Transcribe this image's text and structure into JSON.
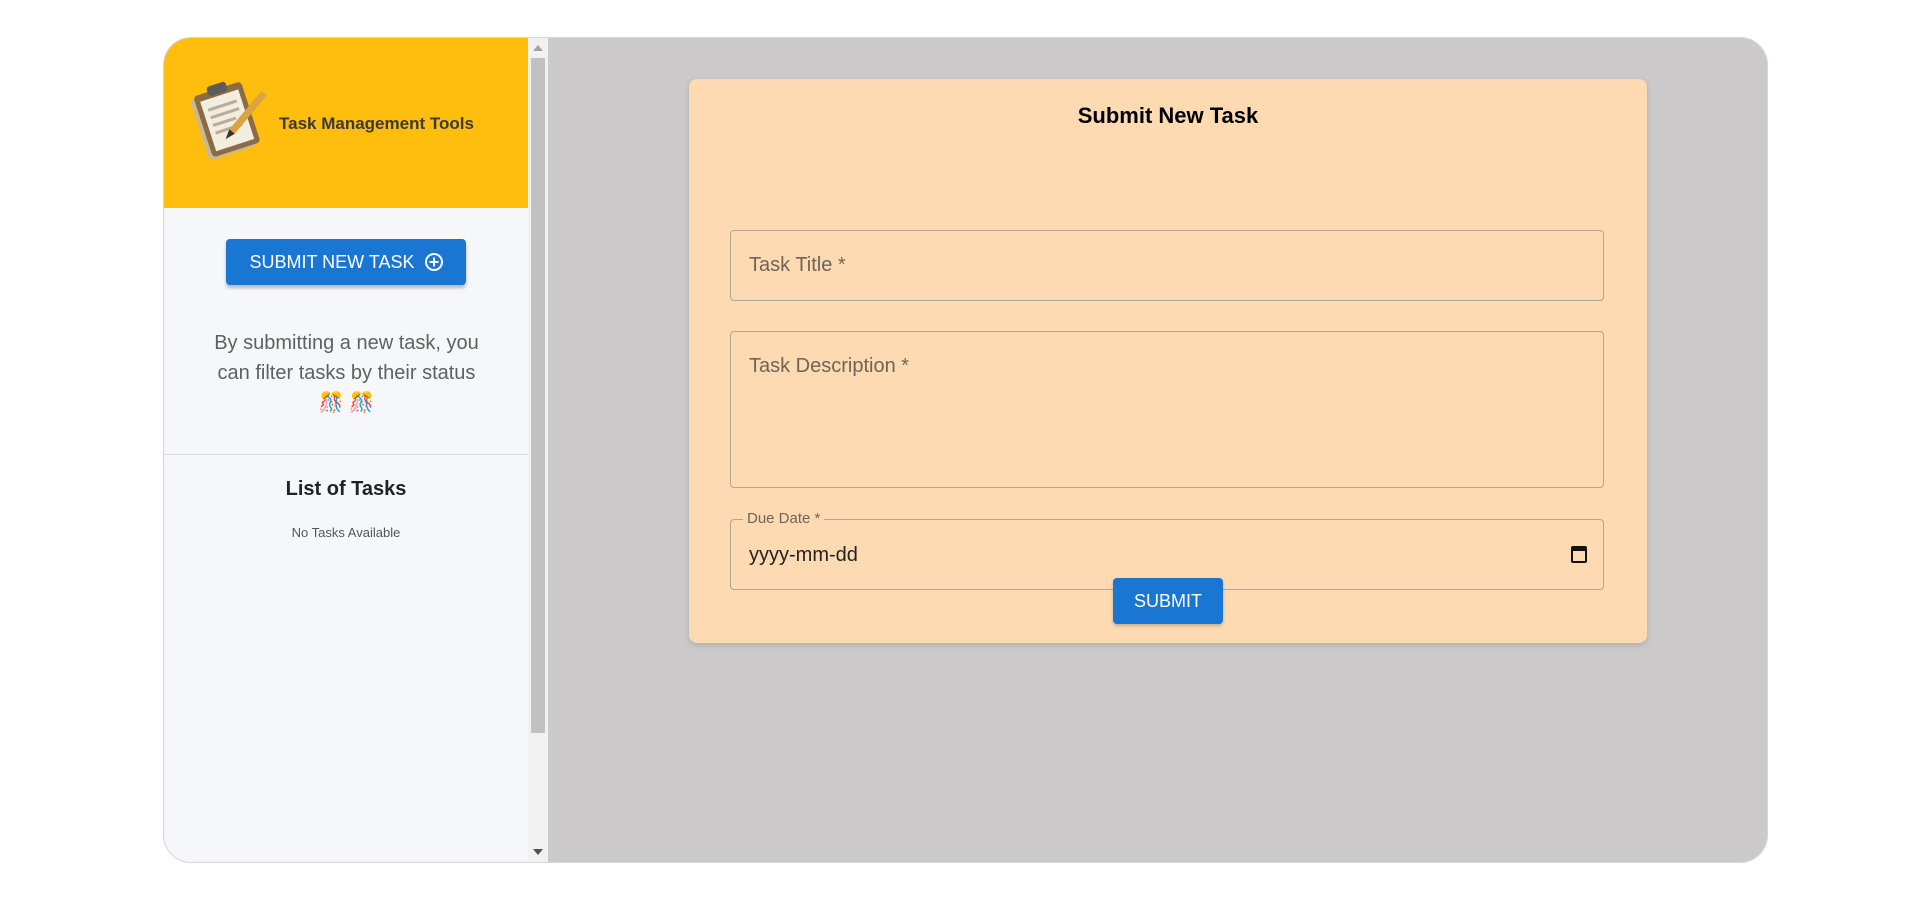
{
  "app": {
    "title": "Task Management Tools"
  },
  "sidebar": {
    "new_task_button": "SUBMIT NEW TASK",
    "new_task_icon": "plus-circle-icon",
    "info_text": "By submitting a new task, you can filter tasks by their status 🎊 🎊",
    "list_title": "List of Tasks",
    "empty_text": "No Tasks Available"
  },
  "form": {
    "title": "Submit New Task",
    "task_title_placeholder": "Task Title *",
    "task_description_placeholder": "Task Description *",
    "due_date_label": "Due Date *",
    "due_date_value": "yyyy-mm-dd",
    "submit_label": "SUBMIT"
  },
  "colors": {
    "header": "#ffbd0d",
    "primary": "#1976d2",
    "card": "#fddab2",
    "background": "#cbc9ca"
  }
}
